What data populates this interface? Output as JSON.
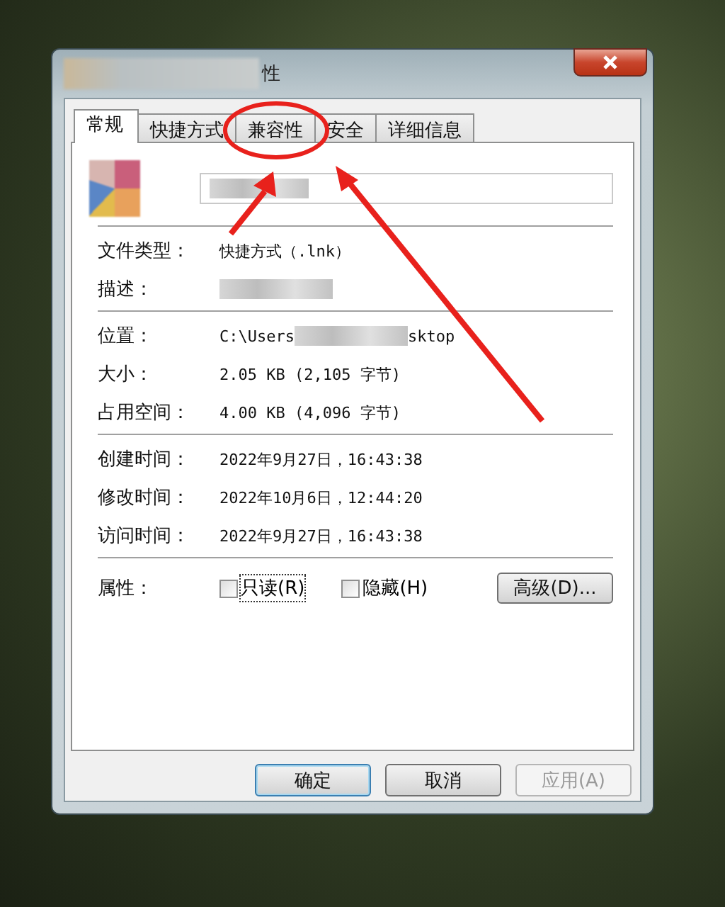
{
  "window": {
    "title": "性"
  },
  "tabs": [
    {
      "label": "常规",
      "selected": true
    },
    {
      "label": "快捷方式",
      "selected": false
    },
    {
      "label": "兼容性",
      "selected": false
    },
    {
      "label": "安全",
      "selected": false
    },
    {
      "label": "详细信息",
      "selected": false
    }
  ],
  "sections": [
    [
      {
        "label": "文件类型：",
        "parts": [
          {
            "kind": "text",
            "text": "快捷方式（.lnk）"
          }
        ]
      },
      {
        "label": "描述：",
        "parts": [
          {
            "kind": "blurred"
          }
        ]
      }
    ],
    [
      {
        "label": "位置：",
        "parts": [
          {
            "kind": "text",
            "text": "C:\\Users"
          },
          {
            "kind": "blurred"
          },
          {
            "kind": "text",
            "text": "sktop"
          }
        ]
      },
      {
        "label": "大小：",
        "parts": [
          {
            "kind": "text",
            "text": "2.05 KB (2,105 字节)"
          }
        ]
      },
      {
        "label": "占用空间：",
        "parts": [
          {
            "kind": "text",
            "text": "4.00 KB (4,096 字节)"
          }
        ]
      }
    ],
    [
      {
        "label": "创建时间：",
        "parts": [
          {
            "kind": "text",
            "text": "2022年9月27日，16:43:38"
          }
        ]
      },
      {
        "label": "修改时间：",
        "parts": [
          {
            "kind": "text",
            "text": "2022年10月6日，12:44:20"
          }
        ]
      },
      {
        "label": "访问时间：",
        "parts": [
          {
            "kind": "text",
            "text": "2022年9月27日，16:43:38"
          }
        ]
      }
    ]
  ],
  "attributes": {
    "label": "属性：",
    "checkboxes": [
      {
        "label": "只读(R)",
        "checked": false
      },
      {
        "label": "隐藏(H)",
        "checked": false
      }
    ],
    "advanced_button": "高级(D)..."
  },
  "buttons": [
    {
      "label": "确定",
      "disabled": false
    },
    {
      "label": "取消",
      "disabled": false
    },
    {
      "label": "应用(A)",
      "disabled": true
    }
  ]
}
